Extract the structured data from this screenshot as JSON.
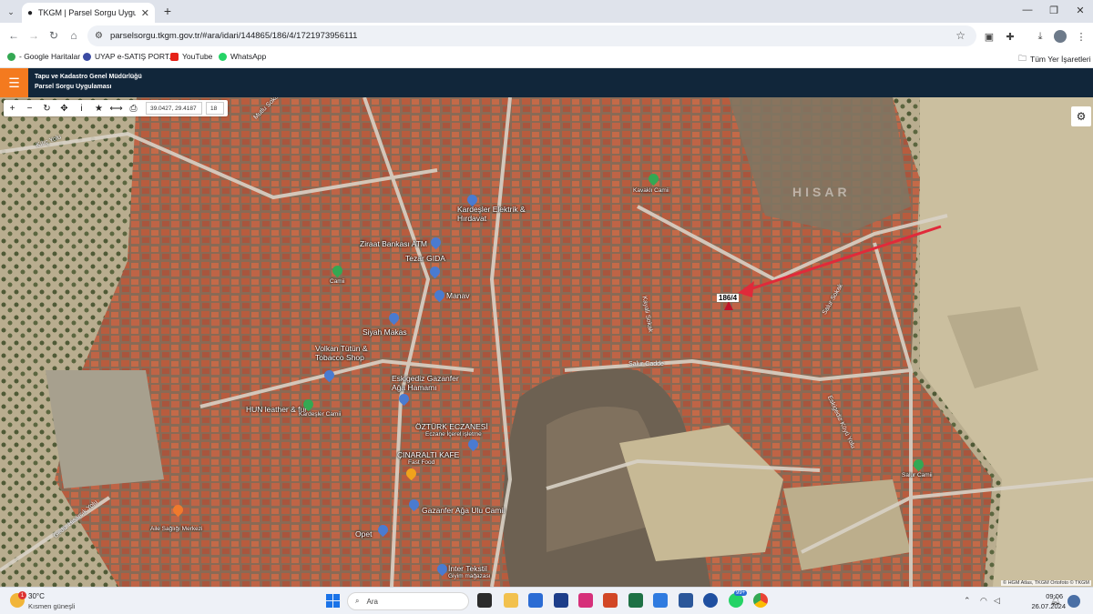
{
  "browser": {
    "tab_title": "TKGM | Parsel Sorgu Uygulaması",
    "url": "parselsorgu.tkgm.gov.tr/#ara/idari/144865/186/4/1721973956111",
    "bookmarks": [
      {
        "label": "- Google Haritalar",
        "color": "#34a853"
      },
      {
        "label": "UYAP e-SATIŞ PORT...",
        "color": "#3b4ba3"
      },
      {
        "label": "YouTube",
        "color": "#e62117"
      },
      {
        "label": "WhatsApp",
        "color": "#25d366"
      }
    ],
    "all_bookmarks": "Tüm Yer İşaretleri"
  },
  "app": {
    "org": "Tapu ve Kadastro Genel Müdürlüğü",
    "name": "Parsel Sorgu Uygulaması",
    "accent_color": "#f47a1f",
    "header_color": "#11263a"
  },
  "map": {
    "coordinates": "39.0427, 29.4187",
    "zoom": "18",
    "parcel": "186/4",
    "area_label": "HISAR",
    "attribution": "© HGM Atlas, TKGM Ortofoto © TKGM",
    "places": [
      {
        "name": "Kavaklı Camii"
      },
      {
        "name": "Kardeşler Elektrik & Hırdavat"
      },
      {
        "name": "Ziraat Bankası ATM"
      },
      {
        "name": "Tezar GIDA"
      },
      {
        "name": "Camii"
      },
      {
        "name": "Manav"
      },
      {
        "name": "Siyah Makas"
      },
      {
        "name": "Volkan Tütün & Tobacco Shop"
      },
      {
        "name": "Eskigediz Gazanfer Ağa Hamamı"
      },
      {
        "name": "HUN leather & fur"
      },
      {
        "name": "Kardeşler Camii"
      },
      {
        "name": "ÖZTÜRK ECZANESİ"
      },
      {
        "name": "Eczane İçerel işletme"
      },
      {
        "name": "ÇINARALTI KAFE"
      },
      {
        "name": "Fast Food"
      },
      {
        "name": "Gazanfer Ağa Ulu Camii"
      },
      {
        "name": "Aile Sağlığı Merkezi"
      },
      {
        "name": "Opet"
      },
      {
        "name": "İnter Tekstil"
      },
      {
        "name": "Giyim mağazası"
      },
      {
        "name": "Salur Camii"
      }
    ],
    "roads": [
      {
        "name": "Salur Cadde"
      },
      {
        "name": "Eskigediz Köyü Yolu"
      },
      {
        "name": "Gediz Hisarcık Yolu"
      },
      {
        "name": "Kayali Sokak"
      },
      {
        "name": "Kılıç Yolu"
      },
      {
        "name": "Mutlu Sokak"
      },
      {
        "name": "Salur Sokak"
      }
    ]
  },
  "taskbar": {
    "temperature": "30°C",
    "weather": "Kısmen güneşli",
    "notification_count": "1",
    "search_placeholder": "Ara",
    "time": "09:06",
    "date": "26.07.2024",
    "whatsapp_badge": "99+"
  }
}
